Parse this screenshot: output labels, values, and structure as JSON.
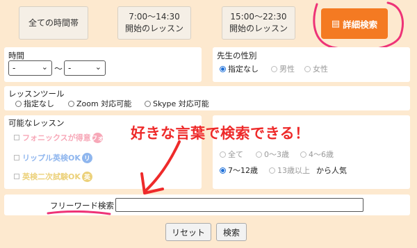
{
  "time_filters": {
    "all": "全ての時間帯",
    "morning_line1": "7:00〜14:30",
    "morning_line2": "開始のレッスン",
    "evening_line1": "15:00〜22:30",
    "evening_line2": "開始のレッスン"
  },
  "detail_search": {
    "label": "詳細検索",
    "icon": "list-icon",
    "color": "#f47a22"
  },
  "time_panel": {
    "label": "時間",
    "from_value": "-",
    "separator": "〜",
    "to_value": "-"
  },
  "gender_panel": {
    "label": "先生の性別",
    "options": [
      "指定なし",
      "男性",
      "女性"
    ],
    "selected": "指定なし"
  },
  "tool_panel": {
    "label": "レッスンツール",
    "options": [
      "指定なし",
      "Zoom 対応可能",
      "Skype 対応可能"
    ]
  },
  "lesson_panel": {
    "label": "可能なレッスン",
    "items": [
      {
        "label": "フォニックスが得意",
        "badge": "フォ",
        "color": "#f7a8b8"
      },
      {
        "label": "リップル英検OK",
        "badge": "リ",
        "color": "#8fb6ee"
      },
      {
        "label": "英検二次試験OK",
        "badge": "英",
        "color": "#ecd17a"
      }
    ]
  },
  "age_panel": {
    "row1": [
      "全て",
      "0〜3歳",
      "4〜6歳"
    ],
    "row2": [
      "7〜12歳",
      "13歳以上"
    ],
    "selected": "7〜12歳",
    "suffix": "から人気"
  },
  "overlay": {
    "text": "好きな言葉で検索できる！",
    "color": "#ee2a2a"
  },
  "freeword": {
    "label": "フリーワード検索",
    "value": ""
  },
  "actions": {
    "reset": "リセット",
    "search": "検索"
  }
}
